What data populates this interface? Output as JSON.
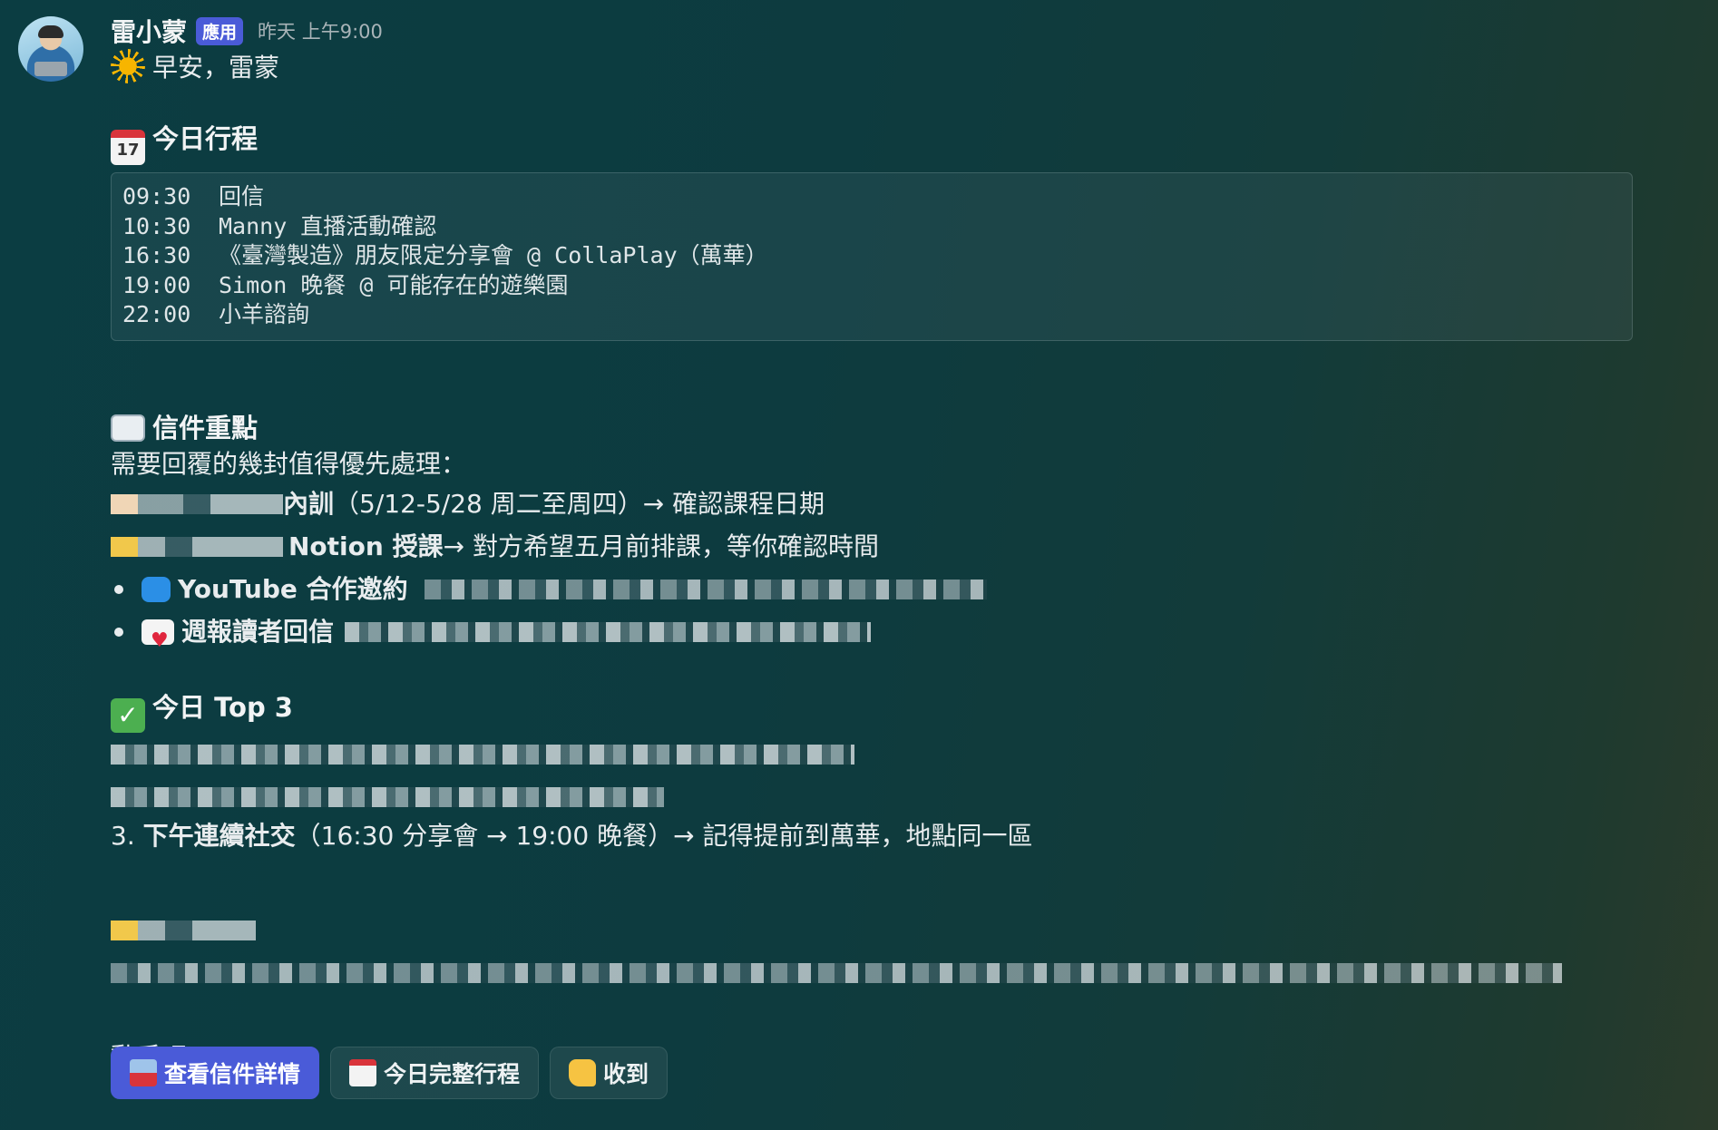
{
  "message": {
    "sender": "雷小蒙",
    "badge": "應用",
    "time": "昨天 上午9:00",
    "greeting": "早安，雷蒙"
  },
  "schedule": {
    "title": "今日行程",
    "icon_label": "17",
    "items": [
      {
        "time": "09:30",
        "text": "回信"
      },
      {
        "time": "10:30",
        "text": "Manny 直播活動確認"
      },
      {
        "time": "16:30",
        "text": "《臺灣製造》朋友限定分享會 @ CollaPlay（萬華）"
      },
      {
        "time": "19:00",
        "text": "Simon 晚餐 @ 可能存在的遊樂園"
      },
      {
        "time": "22:00",
        "text": "小羊諮詢"
      }
    ]
  },
  "mail": {
    "title": "信件重點",
    "intro": "需要回覆的幾封值得優先處理：",
    "items": [
      {
        "bold": "內訓",
        "text": "（5/12-5/28 周二至周四）→ 確認課程日期"
      },
      {
        "bold": "Notion 授課",
        "text": "→ 對方希望五月前排課，等你確認時間"
      },
      {
        "bold": "YouTube 合作邀約",
        "text": ""
      },
      {
        "bold": "週報讀者回信",
        "text": ""
      }
    ]
  },
  "top3": {
    "title": "今日 Top 3",
    "item3_num": "3.",
    "item3_bold": "下午連續社交",
    "item3_text": "（16:30 分享會 → 19:00 晚餐）→ 記得提前到萬華，地點同一區"
  },
  "closing": "動手吧。",
  "buttons": {
    "mail_details": "查看信件詳情",
    "full_schedule": "今日完整行程",
    "ack": "收到"
  },
  "colors": {
    "accent": "#4a5bd8",
    "background": "#0d3b3f"
  }
}
